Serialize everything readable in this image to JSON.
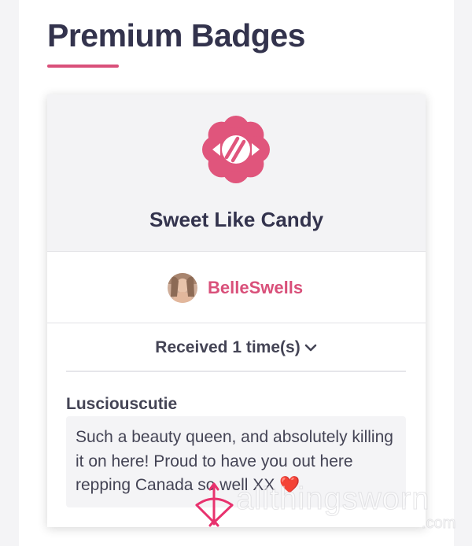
{
  "section": {
    "title": "Premium Badges"
  },
  "badge": {
    "name": "Sweet Like Candy",
    "icon": "candy-flower-icon",
    "accent_color": "#e0557c"
  },
  "owner": {
    "username": "BelleSwells",
    "avatar": "avatar"
  },
  "received": {
    "label": "Received 1 time(s)",
    "toggle_icon": "chevron-down-icon"
  },
  "entries": [
    {
      "giver": "Lusciouscutie",
      "message": "Such a beauty queen, and absolutely killing it on here! Proud to have you out here repping Canada so well XX",
      "emoji": "❤️"
    }
  ],
  "watermark": {
    "text": "allthingsworn",
    "suffix": ".com",
    "logo": "bow-and-arrow-logo"
  }
}
